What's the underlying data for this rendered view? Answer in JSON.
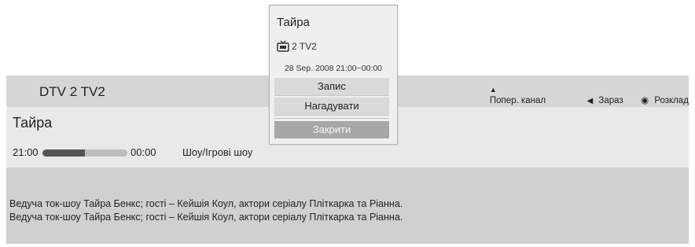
{
  "header": {
    "channel": "DTV 2 TV2",
    "hints": {
      "change_channel": "Попер. канал",
      "now": "Зараз",
      "schedule": "Розклад"
    }
  },
  "program": {
    "title": "Тайра",
    "start_time": "21:00",
    "end_time": "00:00",
    "genre": "Шоу/Ігрові шоу",
    "progress": 0.5
  },
  "description": {
    "lines": [
      "Ведуча ток-шоу Тайра Бенкс; гості – Кейшія Коул, актори серіалу Пліткарка та Ріанна.",
      "Ведуча ток-шоу Тайра Бенкс; гості – Кейшія Коул, актори серіалу Пліткарка та Ріанна."
    ]
  },
  "popup": {
    "title": "Тайра",
    "channel": "2 TV2",
    "datetime": "28 Sep. 2008 21:00~00:00",
    "record_label": "Запис",
    "remind_label": "Нагадувати",
    "close_label": "Закрити"
  },
  "colors": {
    "panel_bg": "#d4d4d4",
    "progress_fill": "#555555",
    "close_button_bg": "#a7a7a7"
  },
  "icons": [
    "tv-icon",
    "up-down-arrows-icon",
    "left-arrow-icon",
    "radio-dot-icon"
  ]
}
